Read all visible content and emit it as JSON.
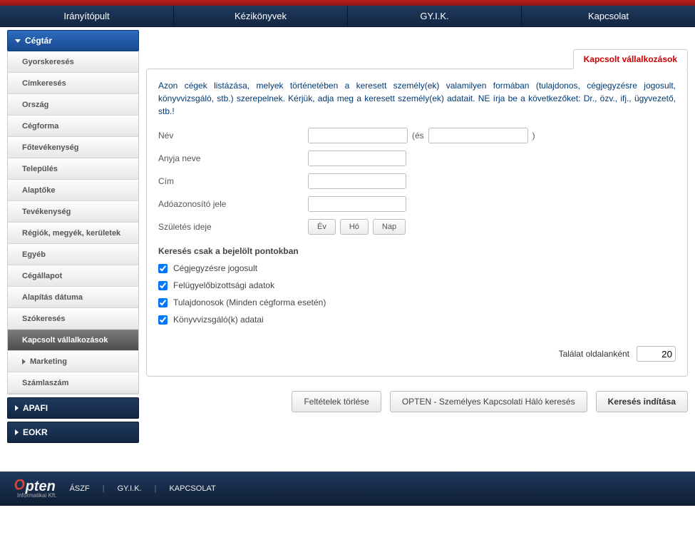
{
  "nav": {
    "items": [
      "Irányítópult",
      "Kézikönyvek",
      "GY.I.K.",
      "Kapcsolat"
    ]
  },
  "sidebar": {
    "header": "Cégtár",
    "items": [
      "Gyorskeresés",
      "Címkeresés",
      "Ország",
      "Cégforma",
      "Főtevékenység",
      "Település",
      "Alaptőke",
      "Tevékenység",
      "Régiók, megyék, kerületek",
      "Egyéb",
      "Cégállapot",
      "Alapítás dátuma",
      "Szókeresés",
      "Kapcsolt vállalkozások",
      "Marketing",
      "Számlaszám"
    ],
    "sections": [
      "APAFI",
      "EOKR"
    ]
  },
  "content": {
    "tab_label": "Kapcsolt vállalkozások",
    "intro": "Azon cégek listázása, melyek történetében a keresett személy(ek) valamilyen formában (tulajdonos, cégjegyzésre jogosult, könyvvizsgáló, stb.) szerepelnek. Kérjük, adja meg a keresett személy(ek) adatait. NE írja be a következőket: Dr., özv., ifj., ügyvezető, stb.!",
    "labels": {
      "nev": "Név",
      "es": "(és",
      "close": ")",
      "anyja": "Anyja neve",
      "cim": "Cím",
      "ado": "Adóazonosító jele",
      "szul": "Születés ideje"
    },
    "date_buttons": {
      "ev": "Év",
      "ho": "Hó",
      "nap": "Nap"
    },
    "section_title": "Keresés csak a bejelölt pontokban",
    "checks": [
      "Cégjegyzésre jogosult",
      "Felügyelőbizottsági adatok",
      "Tulajdonosok (Minden cégforma esetén)",
      "Könyvvizsgáló(k) adatai"
    ],
    "results_label": "Találat oldalanként",
    "results_value": "20",
    "buttons": {
      "clear": "Feltételek törlése",
      "opten": "OPTEN - Személyes Kapcsolati Háló keresés",
      "search": "Keresés indítása"
    }
  },
  "footer": {
    "logo_main": "Opten",
    "logo_sub": "Informatikai Kft.",
    "links": [
      "ÁSZF",
      "GY.I.K.",
      "KAPCSOLAT"
    ]
  }
}
